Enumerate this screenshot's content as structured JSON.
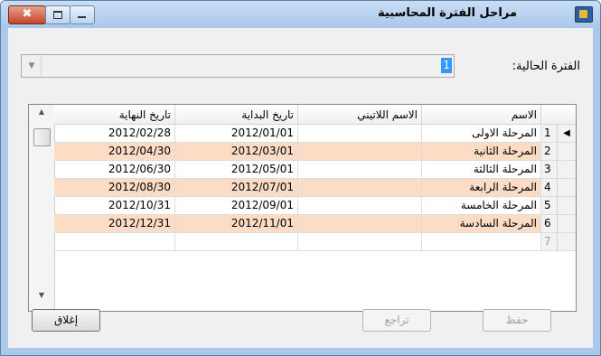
{
  "window": {
    "title": "مراحل الفترة المحاسبية",
    "close_glyph": "✖",
    "app_icon": "calendar-app-icon"
  },
  "period": {
    "label": "الفترة الحالية:",
    "value": "1"
  },
  "grid": {
    "columns": {
      "name": "الاسم",
      "latin_name": "الاسم اللاتيني",
      "start_date": "تاريخ البداية",
      "end_date": "تاريخ النهاية"
    },
    "rows": [
      {
        "num": "1",
        "name": "المرحلة الاولى",
        "latin_name": "",
        "start_date": "2012/01/01",
        "end_date": "2012/02/28",
        "current": "◀"
      },
      {
        "num": "2",
        "name": "المرحلة الثانية",
        "latin_name": "",
        "start_date": "2012/03/01",
        "end_date": "2012/04/30",
        "current": ""
      },
      {
        "num": "3",
        "name": "المرحلة الثالثة",
        "latin_name": "",
        "start_date": "2012/05/01",
        "end_date": "2012/06/30",
        "current": ""
      },
      {
        "num": "4",
        "name": "المرحلة الرابعة",
        "latin_name": "",
        "start_date": "2012/07/01",
        "end_date": "2012/08/30",
        "current": ""
      },
      {
        "num": "5",
        "name": "المرحلة الخامسة",
        "latin_name": "",
        "start_date": "2012/09/01",
        "end_date": "2012/10/31",
        "current": ""
      },
      {
        "num": "6",
        "name": "المرحلة السادسة",
        "latin_name": "",
        "start_date": "2012/11/01",
        "end_date": "2012/12/31",
        "current": ""
      },
      {
        "num": "7",
        "name": "",
        "latin_name": "",
        "start_date": "",
        "end_date": "",
        "current": ""
      }
    ],
    "alt_row_color": "#fcdcc4"
  },
  "buttons": {
    "save": "حفظ",
    "undo": "تراجع",
    "close": "إغلاق"
  }
}
